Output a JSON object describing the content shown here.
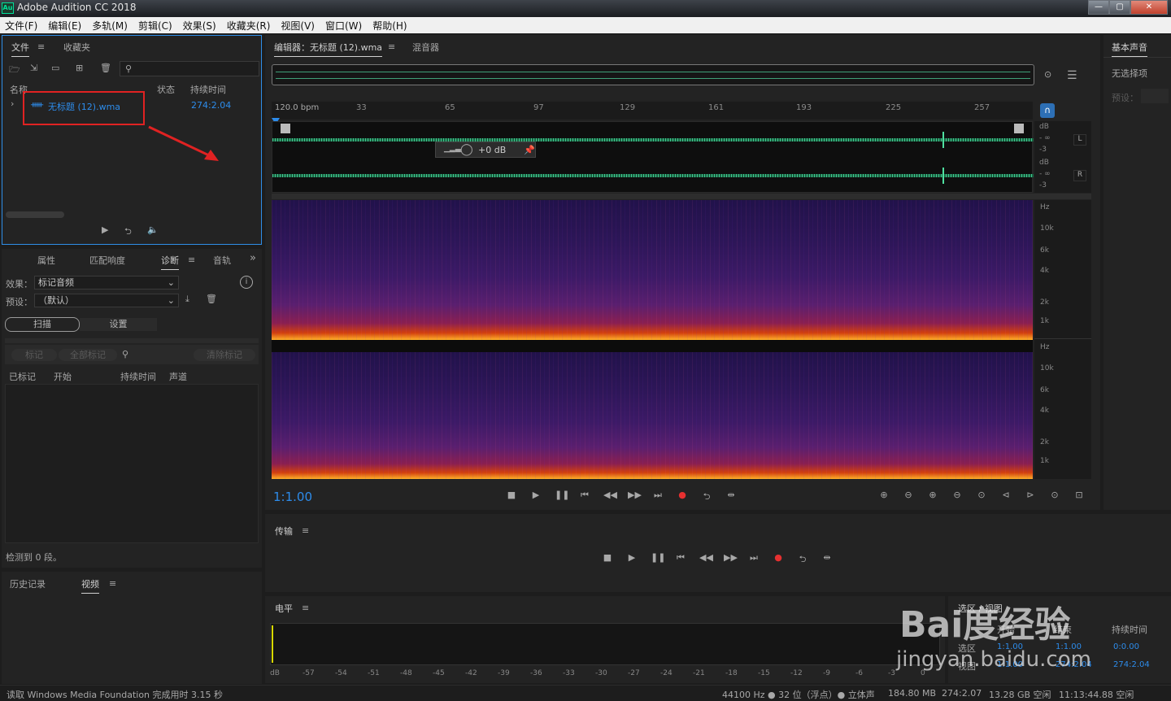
{
  "window": {
    "title": "Adobe Audition CC 2018",
    "app_icon": "Au"
  },
  "menu": [
    "文件(F)",
    "编辑(E)",
    "多轨(M)",
    "剪辑(C)",
    "效果(S)",
    "收藏夹(R)",
    "视图(V)",
    "窗口(W)",
    "帮助(H)"
  ],
  "files_panel": {
    "tabs": [
      "文件",
      "收藏夹"
    ],
    "columns": {
      "name": "名称",
      "status": "状态",
      "duration": "持续时间"
    },
    "rows": [
      {
        "name": "无标题 (12).wma",
        "duration": "274:2.04"
      }
    ]
  },
  "diagnostics": {
    "tabs": [
      "属性",
      "匹配响度",
      "诊断",
      "音轨"
    ],
    "effect_label": "效果：",
    "effect_value": "标记音频",
    "preset_label": "预设：",
    "preset_value": "（默认）",
    "scan": "扫描",
    "settings": "设置",
    "mark": "标记",
    "mark_all": "全部标记",
    "clear_marks": "清除标记",
    "columns": [
      "已标记",
      "开始",
      "持续时间",
      "声道"
    ],
    "detected": "检测到 0 段。"
  },
  "history": {
    "tabs": [
      "历史记录",
      "视频"
    ]
  },
  "editor": {
    "tabs": [
      "编辑器：无标题 (12).wma",
      "混音器"
    ],
    "ruler_bpm": "120.0 bpm",
    "ruler_labels": [
      "33",
      "65",
      "97",
      "129",
      "161",
      "193",
      "225",
      "257"
    ],
    "gain": "+0 dB",
    "db_labels": [
      "dB",
      "- ∞",
      "-3"
    ],
    "channels": [
      "L",
      "R"
    ],
    "hz_labels": [
      "Hz",
      "10k",
      "6k",
      "4k",
      "2k",
      "1k"
    ],
    "time": "1:1.00"
  },
  "right_panel": {
    "title": "基本声音",
    "no_selection": "无选择项",
    "preset": "预设："
  },
  "transport": {
    "title": "传输"
  },
  "levels": {
    "title": "电平",
    "scale": [
      "dB",
      "-57",
      "-54",
      "-51",
      "-48",
      "-45",
      "-42",
      "-39",
      "-36",
      "-33",
      "-30",
      "-27",
      "-24",
      "-21",
      "-18",
      "-15",
      "-12",
      "-9",
      "-6",
      "-3",
      "0"
    ]
  },
  "selection": {
    "title": "选区 / 视图",
    "headers": [
      "开始",
      "结束",
      "持续时间"
    ],
    "rows": [
      {
        "label": "选区",
        "start": "1:1.00",
        "end": "1:1.00",
        "dur": "0:0.00"
      },
      {
        "label": "视图",
        "start": "1:1.00",
        "end": "274:2.04",
        "dur": "274:2.04"
      }
    ]
  },
  "watermark": {
    "line1": "Bai度经验",
    "line2": "jingyan.baidu.com"
  },
  "statusbar": {
    "left": "读取 Windows Media Foundation 完成用时 3.15 秒",
    "rate": "44100 Hz ● 32 位（浮点）● 立体声",
    "size": "184.80 MB",
    "dur": "274:2.07",
    "free": "13.28 GB 空闲",
    "time": "11:13:44.88 空闲"
  }
}
